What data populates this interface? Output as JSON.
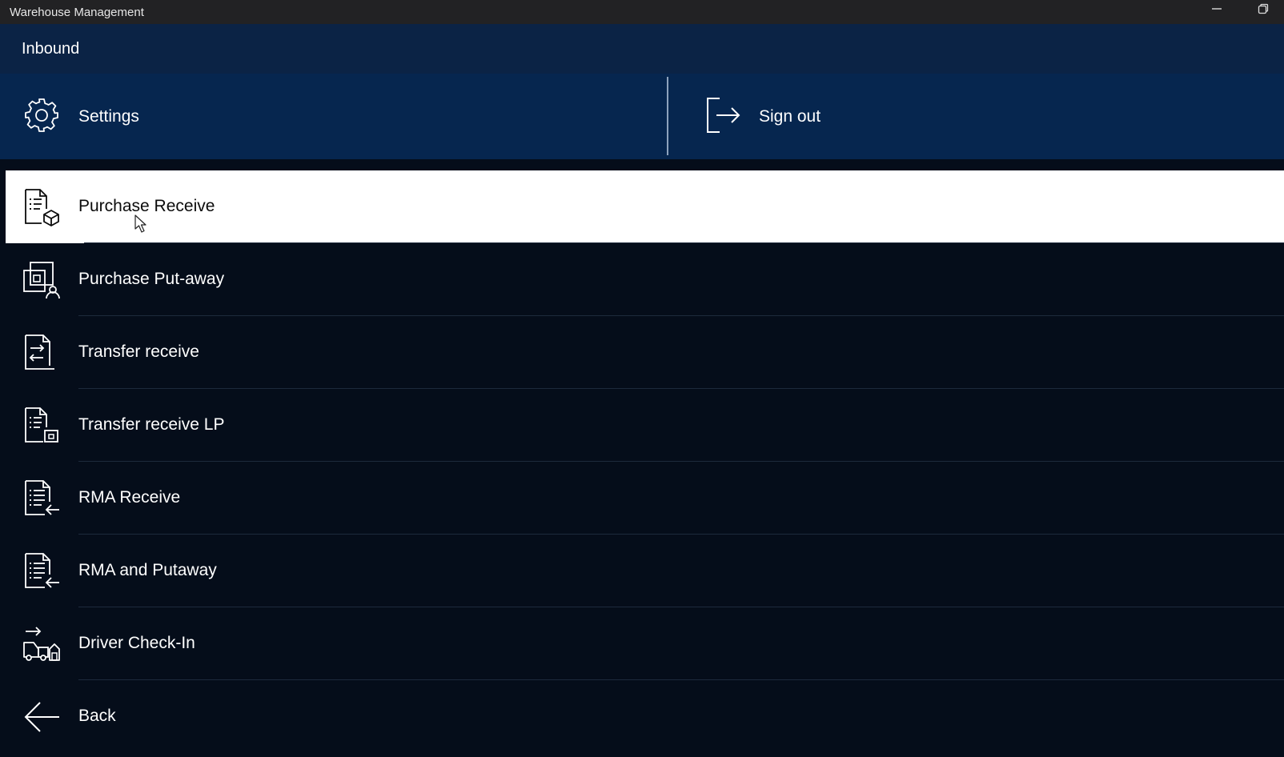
{
  "window": {
    "title": "Warehouse Management",
    "minimize_glyph": "—",
    "restore_glyph": "❐"
  },
  "header": {
    "title": "Inbound"
  },
  "actions": {
    "settings": {
      "label": "Settings",
      "icon": "gear-icon"
    },
    "signout": {
      "label": "Sign out",
      "icon": "sign-out-icon"
    }
  },
  "menu": {
    "selected_index": 0,
    "items": [
      {
        "label": "Purchase Receive",
        "icon": "document-box-icon"
      },
      {
        "label": "Purchase Put-away",
        "icon": "box-person-icon"
      },
      {
        "label": "Transfer receive",
        "icon": "document-transfer-icon"
      },
      {
        "label": "Transfer receive LP",
        "icon": "document-license-plate-icon"
      },
      {
        "label": "RMA Receive",
        "icon": "document-return-icon"
      },
      {
        "label": "RMA and Putaway",
        "icon": "document-return-icon"
      },
      {
        "label": "Driver Check-In",
        "icon": "truck-checkin-icon"
      },
      {
        "label": "Back",
        "icon": "arrow-left-icon"
      }
    ]
  },
  "colors": {
    "titlebar": "#222224",
    "header": "#0b2345",
    "actionbar": "#06264f",
    "background": "#050d1a",
    "selected_row": "#ffffff"
  }
}
